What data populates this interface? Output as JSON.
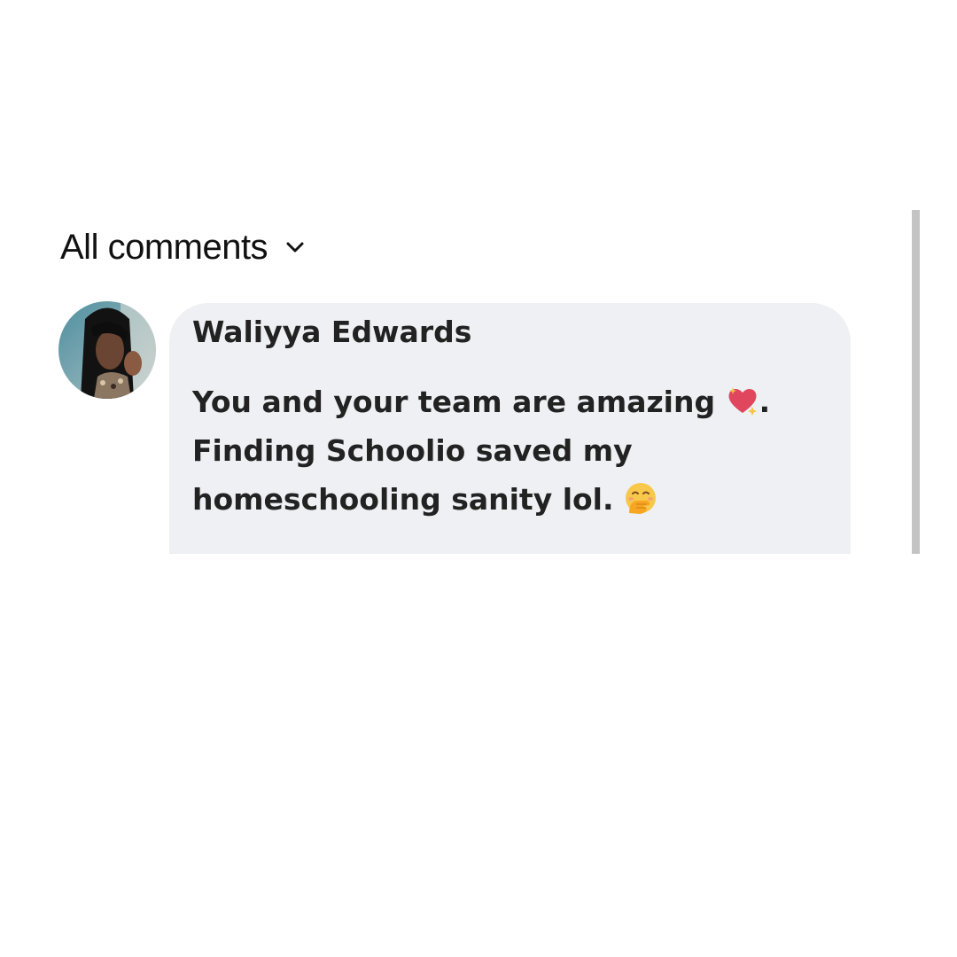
{
  "comments_section": {
    "header_label": "All comments",
    "header_icon": "chevron-down-icon"
  },
  "comment": {
    "author": "Waliyya Edwards",
    "text_line1": "You and your team are amazing",
    "text_line1_end": ".",
    "text_line2": "Finding Schoolio saved my",
    "text_line3": "homeschooling sanity lol.",
    "emoji_1": "sparkling-heart-icon",
    "emoji_2": "face-with-hand-over-mouth-icon"
  },
  "colors": {
    "bubble_background": "#eff0f3",
    "scrollbar": "#c4c4c4",
    "heart": "#e0475e",
    "face": "#f7c84a"
  }
}
